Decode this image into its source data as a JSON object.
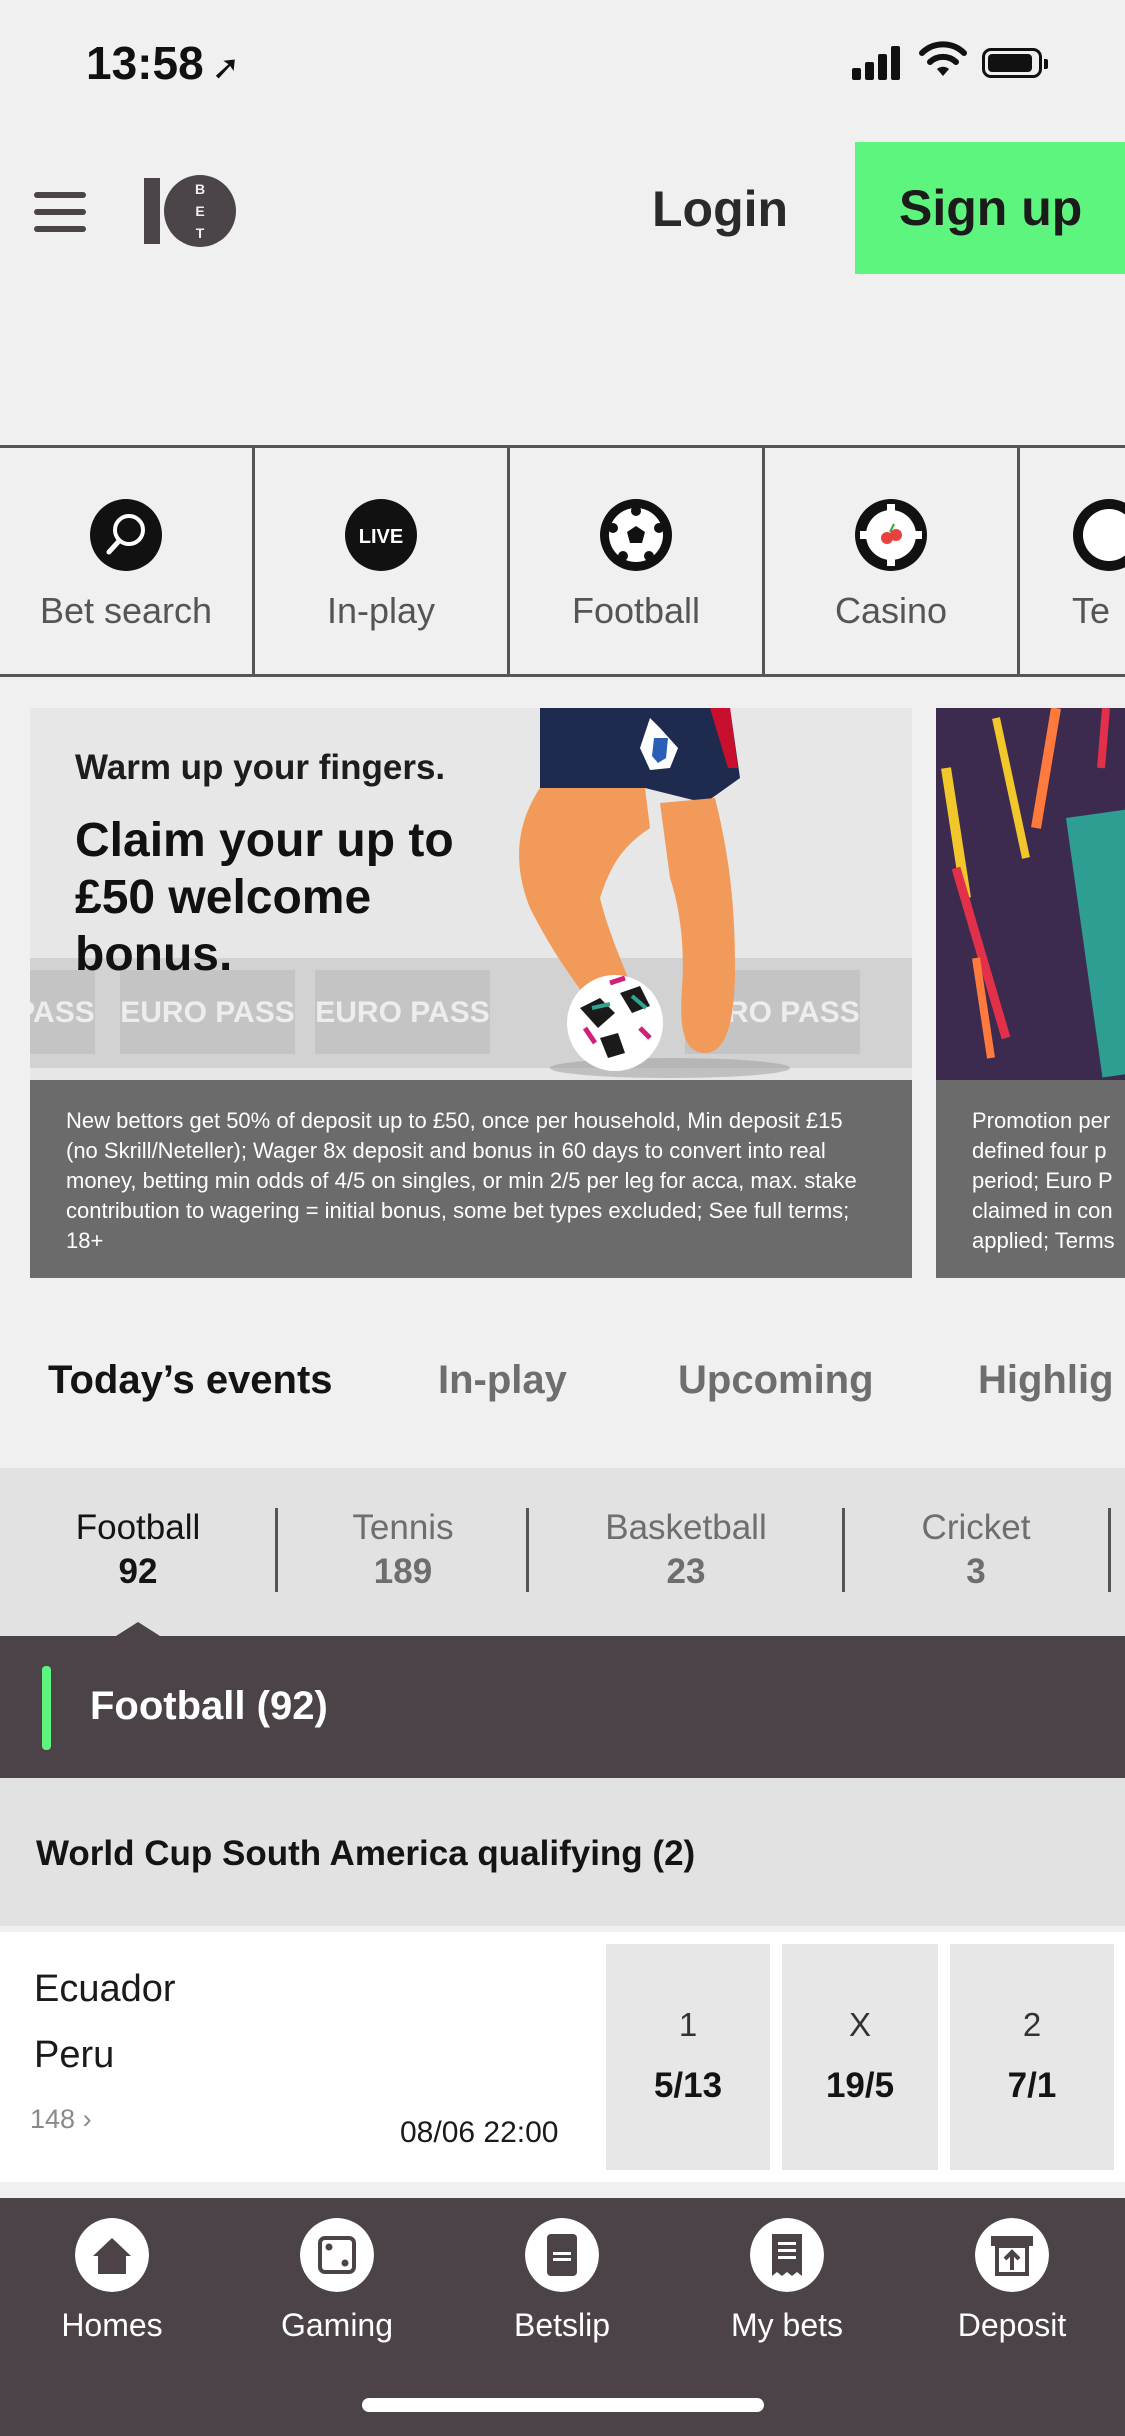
{
  "status": {
    "time": "13:58"
  },
  "header": {
    "login": "Login",
    "signup": "Sign up"
  },
  "quicknav": [
    {
      "label": "Bet search",
      "icon": "search-icon"
    },
    {
      "label": "In-play",
      "icon": "live-icon",
      "badge": "LIVE"
    },
    {
      "label": "Football",
      "icon": "football-icon"
    },
    {
      "label": "Casino",
      "icon": "casino-icon"
    },
    {
      "label": "Te",
      "icon": "tennis-icon"
    }
  ],
  "banner1": {
    "pre": "Warm up your fingers.",
    "headline": "Claim your up to £50 welcome bonus.",
    "stripe": "EURO PASS",
    "terms": "New bettors get 50% of deposit up to £50, once per household, Min deposit £15 (no Skrill/Neteller); Wager 8x deposit and bonus in 60 days to convert into real money, betting min odds of 4/5 on singles, or min 2/5 per leg for acca, max. stake contribution to wagering = initial bonus, some bet types excluded; See full terms; 18+"
  },
  "banner2": {
    "terms": [
      "Promotion per",
      "defined four p",
      "period; Euro P",
      "claimed in con",
      "applied; Terms"
    ]
  },
  "event_tabs": [
    "Today’s events",
    "In-play",
    "Upcoming",
    "Highlig"
  ],
  "sports": [
    {
      "name": "Football",
      "count": "92"
    },
    {
      "name": "Tennis",
      "count": "189"
    },
    {
      "name": "Basketball",
      "count": "23"
    },
    {
      "name": "Cricket",
      "count": "3"
    }
  ],
  "section": {
    "title": "Football  (92)"
  },
  "league": {
    "title": "World Cup South America qualifying  (2)"
  },
  "match": {
    "home": "Ecuador",
    "away": "Peru",
    "markets": "148",
    "kickoff": "08/06  22:00",
    "odds": [
      {
        "label": "1",
        "value": "5/13"
      },
      {
        "label": "X",
        "value": "19/5"
      },
      {
        "label": "2",
        "value": "7/1"
      }
    ]
  },
  "bottomnav": [
    {
      "label": "Homes",
      "icon": "home-icon"
    },
    {
      "label": "Gaming",
      "icon": "dice-icon"
    },
    {
      "label": "Betslip",
      "icon": "betslip-icon"
    },
    {
      "label": "My bets",
      "icon": "receipt-icon"
    },
    {
      "label": "Deposit",
      "icon": "deposit-icon"
    }
  ],
  "colors": {
    "accent_green": "#5ef57f",
    "dark": "#4b4348"
  }
}
